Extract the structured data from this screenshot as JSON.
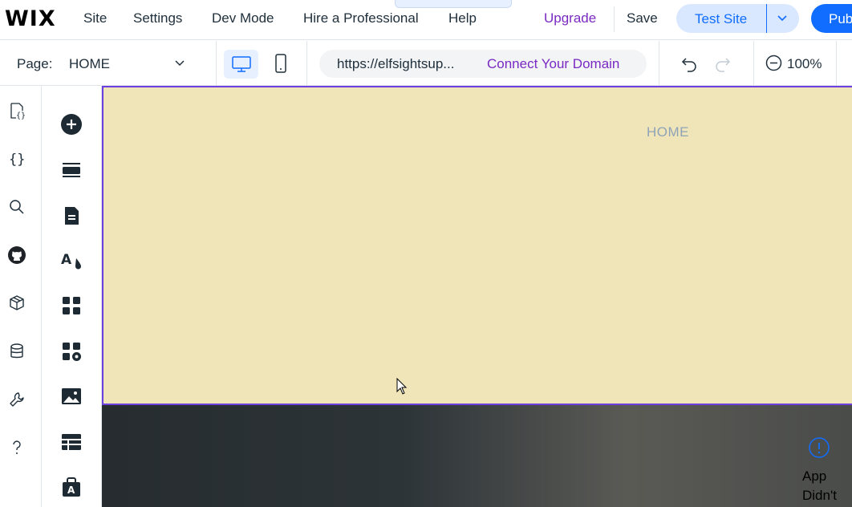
{
  "topbar": {
    "logo": "WIX",
    "menu": [
      "Site",
      "Settings",
      "Dev Mode",
      "Hire a Professional",
      "Help"
    ],
    "upgrade": "Upgrade",
    "save": "Save",
    "test_site": "Test Site",
    "publish": "Pub"
  },
  "secbar": {
    "page_label": "Page:",
    "page_name": "HOME",
    "url": "https://elfsightsup...",
    "connect_domain": "Connect Your Domain",
    "zoom": "100%"
  },
  "left_rail": {
    "icons": [
      "pages-code-icon",
      "code-braces-icon",
      "search-icon",
      "github-icon",
      "package-icon",
      "database-icon",
      "wrench-icon",
      "help-icon"
    ]
  },
  "tool_rail": {
    "icons": [
      "add-elements-icon",
      "sections-icon",
      "pages-icon",
      "theme-icon",
      "apps-icon",
      "business-tools-icon",
      "media-icon",
      "cms-icon",
      "app-market-icon"
    ]
  },
  "canvas": {
    "nav_home": "HOME",
    "app_warning": "App Didn't"
  },
  "colors": {
    "accent_blue": "#116dff",
    "upgrade_purple": "#7a2ac3",
    "header_bg": "#efe5b9",
    "selection_purple": "#6e3fe0"
  }
}
